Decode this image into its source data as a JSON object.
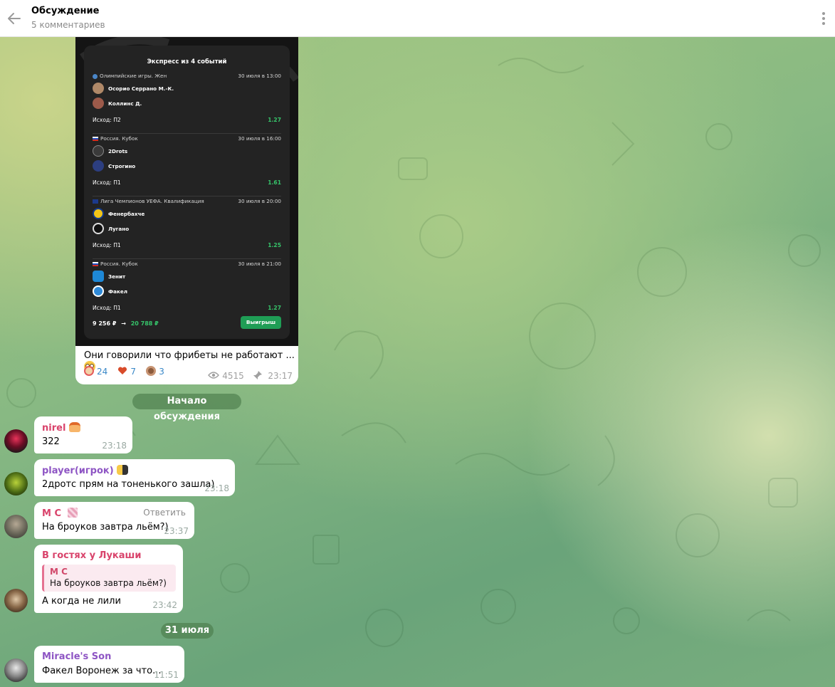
{
  "header": {
    "title": "Обсуждение",
    "subtitle": "5 комментариев"
  },
  "post": {
    "bet": {
      "title": "Экспресс из 4 событий",
      "events": [
        {
          "league": "Олимпийские игры. Жен",
          "date": "30 июля в 13:00",
          "team1": "Осорио Серрано М.-К.",
          "team2": "Коллинс Д.",
          "outcome": "Исход: П2",
          "odds": "1.27"
        },
        {
          "league": "Россия. Кубок",
          "date": "30 июля в 16:00",
          "team1": "2Drots",
          "team2": "Строгино",
          "outcome": "Исход: П1",
          "odds": "1.61"
        },
        {
          "league": "Лига Чемпионов УЕФА. Квалификация",
          "date": "30 июля в 20:00",
          "team1": "Фенербахче",
          "team2": "Лугано",
          "outcome": "Исход: П1",
          "odds": "1.25"
        },
        {
          "league": "Россия. Кубок",
          "date": "30 июля в 21:00",
          "team1": "Зенит",
          "team2": "Факел",
          "outcome": "Исход: П1",
          "odds": "1.27"
        }
      ],
      "stake": "9 256 ₽",
      "arrow": "→",
      "payout": "20 788 ₽",
      "status": "Выигрыш"
    },
    "text": "Они говорили что фрибеты не работают ...",
    "reactions": [
      {
        "emoji": "clown-face-icon",
        "count": "24"
      },
      {
        "emoji": "heart-icon",
        "count": "7"
      },
      {
        "emoji": "monkey-face-icon",
        "count": "3"
      }
    ],
    "views": "4515",
    "time": "23:17"
  },
  "discussion_start": "Начало обсуждения",
  "date_divider": "31 июля",
  "comments": [
    {
      "author": "nirel",
      "author_color": "#d9436b",
      "text": "322",
      "time": "23:18"
    },
    {
      "author": "player(игрок)",
      "author_color": "#8e55c4",
      "text": "2дротс прям на тоненького зашла)",
      "time": "23:18"
    },
    {
      "author": "М С",
      "author_color": "#d9436b",
      "text": "На броуков завтра льём?)",
      "time": "23:37",
      "reply_label": "Ответить"
    },
    {
      "author": "В гостях у Лукаши",
      "author_color": "#d9436b",
      "quote_author": "М С",
      "quote_text": "На броуков завтра льём?)",
      "text": "А когда не лили",
      "time": "23:42"
    },
    {
      "author": "Miracle's Son",
      "author_color": "#8e55c4",
      "text": "Факел Воронеж за что...",
      "time": "11:51"
    }
  ]
}
